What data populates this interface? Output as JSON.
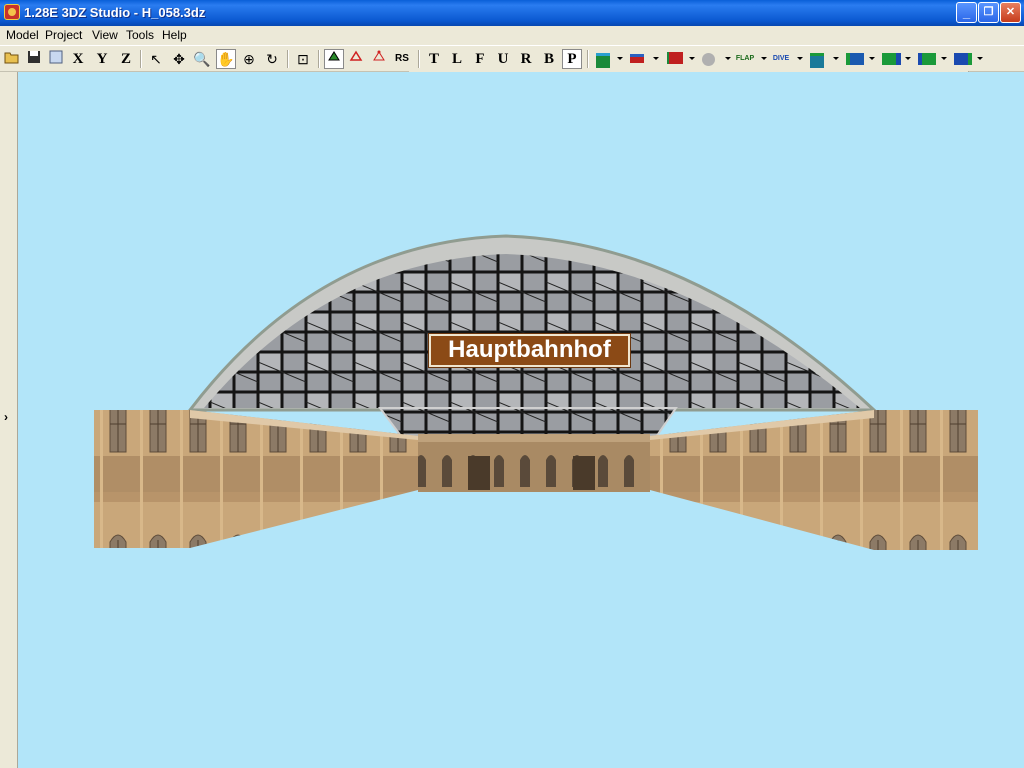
{
  "window": {
    "title": "1.28E 3DZ Studio - H_058.3dz",
    "minimize": "_",
    "maximize": "❐",
    "close": "✕"
  },
  "menu": [
    "Model",
    "Project",
    "View",
    "Tools",
    "Help"
  ],
  "toolbar": {
    "axis_buttons": [
      "X",
      "Y",
      "Z"
    ],
    "view_buttons": [
      "T",
      "L",
      "F",
      "U",
      "R",
      "B",
      "P"
    ],
    "pressed_view": "P",
    "rs_label": "RS",
    "flap_label": "FLAP",
    "dive_label": "DIVE"
  },
  "left_strip": {
    "expand_glyph": "›"
  },
  "viewport": {
    "background": "#b2e5f9",
    "sign_text": "Hauptbahnhof"
  },
  "colors": {
    "titlebar": "#0a58d0",
    "sign": "#8b4a16",
    "stone": "#c9a77a",
    "glass": "#8f9398"
  }
}
